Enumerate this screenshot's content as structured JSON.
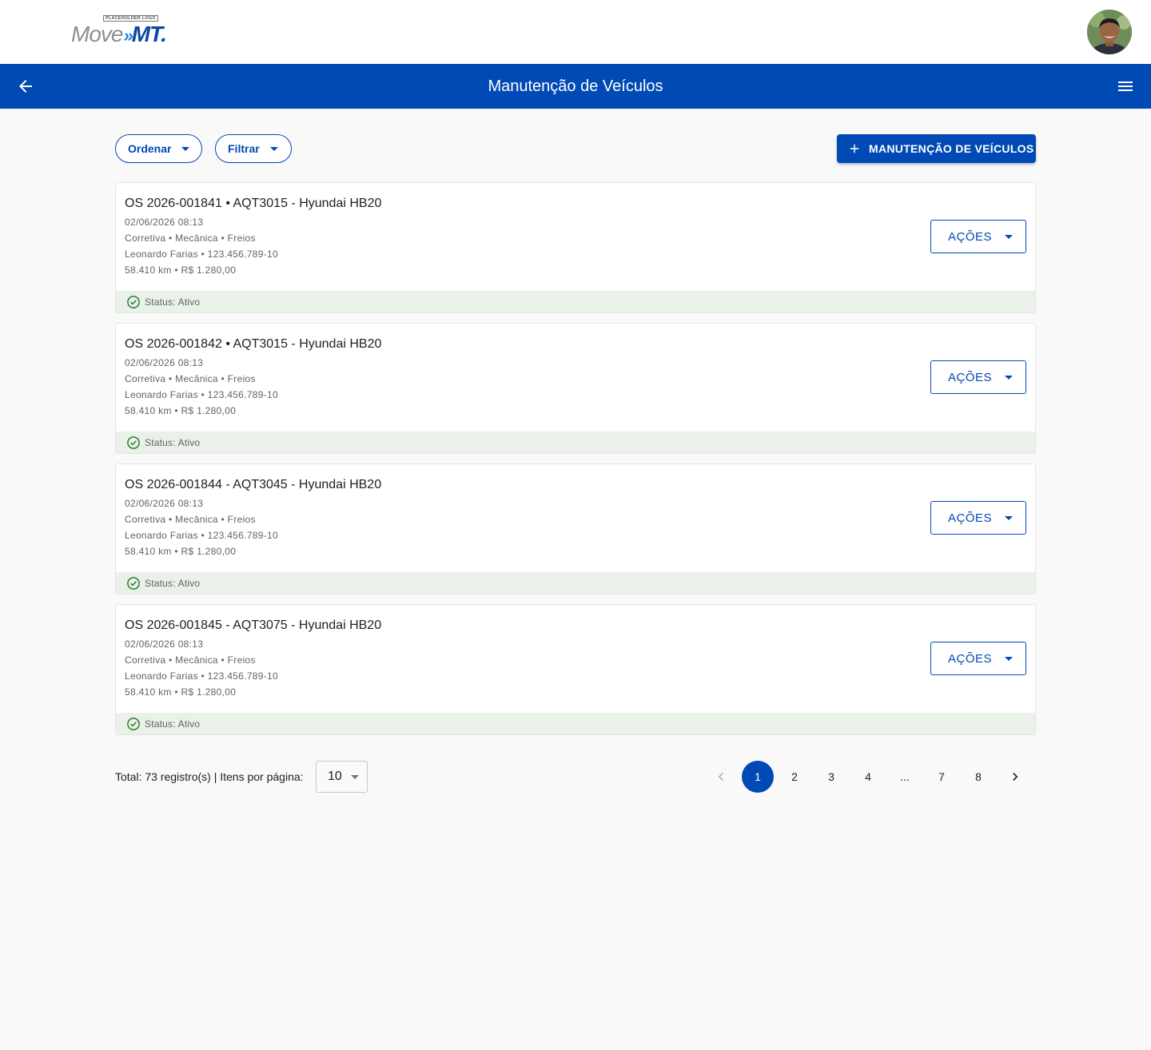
{
  "header": {
    "logo_tag": "PLACEHOLDER LOGO",
    "logo_move": "Move",
    "logo_chevrons": "»",
    "logo_mt": "MT.",
    "avatar_icon": "user-avatar-photo"
  },
  "appbar": {
    "title": "Manutenção de Veículos",
    "back_icon": "arrow-left-icon",
    "menu_icon": "hamburger-menu-icon"
  },
  "toolbar": {
    "sort_label": "Ordenar",
    "filter_label": "Filtrar",
    "add_label": "MANUTENÇÃO DE VEÍCULOS",
    "add_icon": "plus-icon"
  },
  "records": [
    {
      "title": "OS 2026-001841 • AQT3015 - Hyundai HB20",
      "datetime": "02/06/2026 08:13",
      "categories": "Corretiva • Mecânica • Freios",
      "person": "Leonardo Farias • 123.456.789-10",
      "mileage_cost": "58.410 km • R$ 1.280,00",
      "actions_label": "AÇÕES",
      "status": "Status: Ativo"
    },
    {
      "title": "OS 2026-001842 • AQT3015 - Hyundai HB20",
      "datetime": "02/06/2026 08:13",
      "categories": "Corretiva • Mecânica • Freios",
      "person": "Leonardo Farias • 123.456.789-10",
      "mileage_cost": "58.410 km • R$ 1.280,00",
      "actions_label": "AÇÕES",
      "status": "Status: Ativo"
    },
    {
      "title": "OS 2026-001844 - AQT3045 - Hyundai HB20",
      "datetime": "02/06/2026 08:13",
      "categories": "Corretiva • Mecânica • Freios",
      "person": "Leonardo Farias • 123.456.789-10",
      "mileage_cost": "58.410 km • R$ 1.280,00",
      "actions_label": "AÇÕES",
      "status": "Status: Ativo"
    },
    {
      "title": "OS 2026-001845 - AQT3075 - Hyundai HB20",
      "datetime": "02/06/2026 08:13",
      "categories": "Corretiva • Mecânica • Freios",
      "person": "Leonardo Farias • 123.456.789-10",
      "mileage_cost": "58.410 km • R$ 1.280,00",
      "actions_label": "AÇÕES",
      "status": "Status: Ativo"
    }
  ],
  "pagination": {
    "total_text": "Total: 73 registro(s) | Itens por página:",
    "per_page": "10",
    "pages": [
      "1",
      "2",
      "3",
      "4",
      "...",
      "7",
      "8"
    ],
    "current_page": "1",
    "prev_icon": "chevron-left-icon",
    "next_icon": "chevron-right-icon"
  },
  "colors": {
    "primary": "#004ab5",
    "status_bg": "#e9f1e9",
    "status_icon": "#2e7d32",
    "page_bg": "#f9f9f9"
  }
}
